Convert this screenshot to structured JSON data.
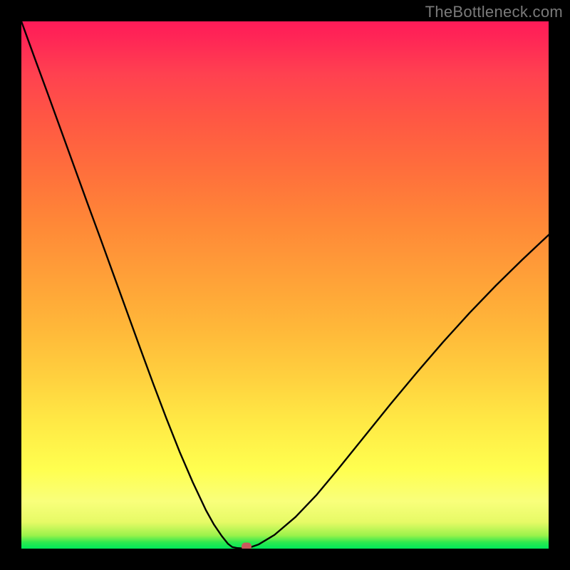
{
  "watermark": "TheBottleneck.com",
  "colors": {
    "frame": "#000000",
    "curve": "#000000",
    "marker": "#c9595c",
    "gradient_top": "#ff1b58",
    "gradient_bottom": "#00e75a"
  },
  "chart_data": {
    "type": "line",
    "title": "",
    "xlabel": "",
    "ylabel": "",
    "xlim": [
      0,
      100
    ],
    "ylim": [
      0,
      100
    ],
    "grid": false,
    "legend": false,
    "description": "Bottleneck percentage curve with a V-shaped minimum",
    "series": [
      {
        "name": "bottleneck-curve",
        "x": [
          0,
          2.5,
          5,
          7.5,
          10,
          12.5,
          15,
          17.5,
          20,
          22.5,
          25,
          27.5,
          30,
          32.5,
          35,
          36.5,
          38,
          39.2,
          40,
          41,
          42.7,
          45,
          48,
          52,
          56,
          60,
          65,
          70,
          75,
          80,
          85,
          90,
          95,
          100
        ],
        "y": [
          100,
          93.1,
          86.3,
          79.4,
          72.5,
          65.6,
          58.8,
          51.9,
          45.0,
          38.1,
          31.3,
          24.7,
          18.4,
          12.6,
          7.3,
          4.6,
          2.4,
          0.9,
          0.3,
          0.1,
          0.0,
          0.8,
          2.6,
          6.0,
          10.2,
          15.0,
          21.2,
          27.4,
          33.4,
          39.2,
          44.7,
          49.9,
          54.8,
          59.5
        ]
      }
    ],
    "marker": {
      "x": 42.7,
      "y": 0.0
    }
  }
}
